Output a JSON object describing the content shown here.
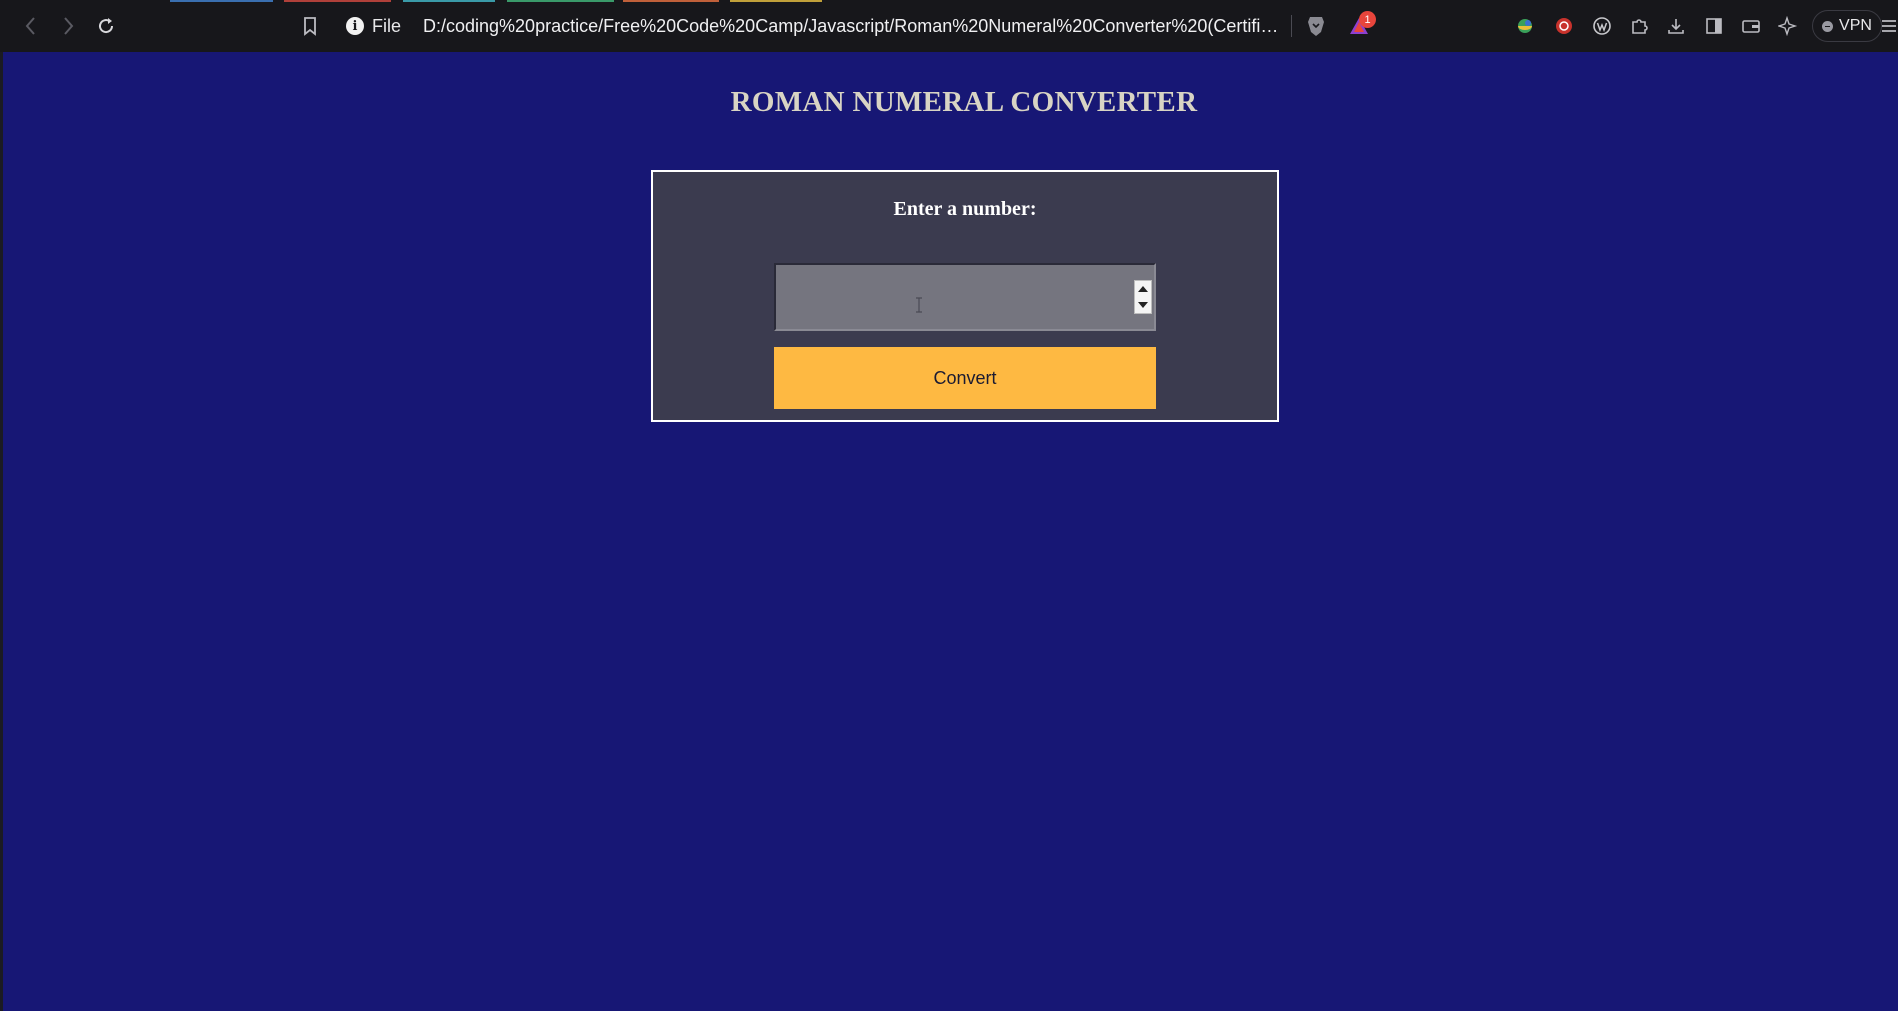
{
  "browser": {
    "site_info_label": "File",
    "url": "D:/coding%20practice/Free%20Code%20Camp/Javascript/Roman%20Numeral%20Converter%20(Certififcatio...",
    "notification_count": "1",
    "vpn_label": "VPN",
    "tab_colors": [
      "#3a6fb0",
      "#b0403a",
      "#3a9aa8",
      "#3a9a6a",
      "#c0603a",
      "#c0a03a"
    ]
  },
  "page": {
    "title": "ROMAN NUMERAL CONVERTER",
    "prompt_label": "Enter a number:",
    "input": {
      "value": "",
      "placeholder": ""
    },
    "convert_label": "Convert"
  },
  "colors": {
    "page_background": "#171775",
    "card_background": "#3b3b4f",
    "button_background": "#feb942",
    "title_color": "#d8d4c4"
  }
}
